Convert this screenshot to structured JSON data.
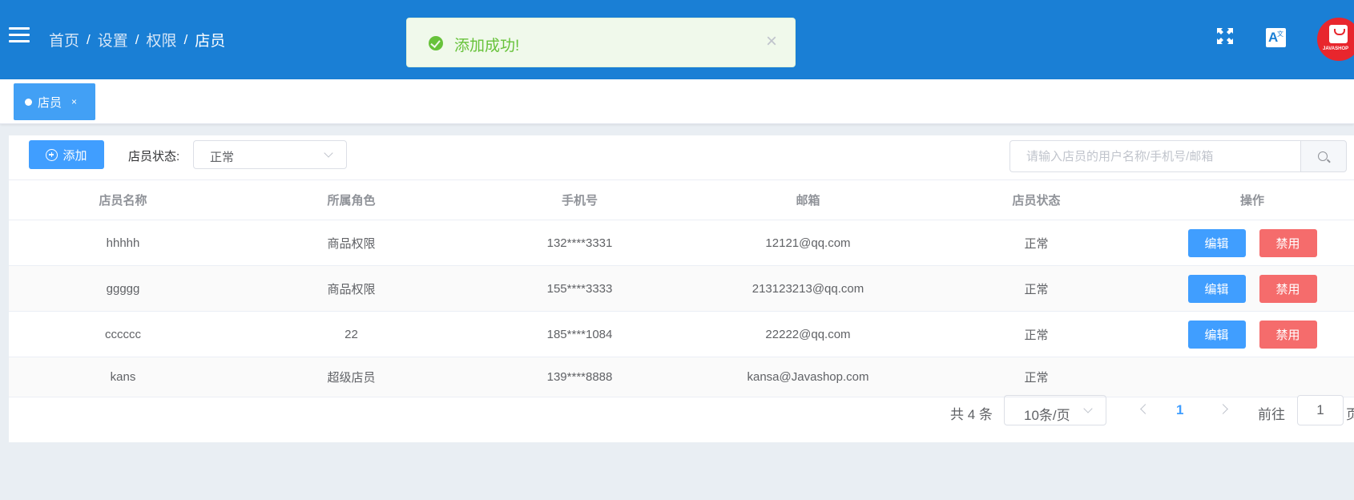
{
  "header": {
    "breadcrumb": [
      "首页",
      "设置",
      "权限",
      "店员"
    ],
    "separator": "/",
    "avatar_brand": "JAVASHOP",
    "lang_glyph_a": "A",
    "lang_glyph_b": "文"
  },
  "toast": {
    "message": "添加成功!",
    "close": "×",
    "color": "#67c23a"
  },
  "tabs": [
    {
      "label": "店员",
      "close": "×"
    }
  ],
  "toolbar": {
    "add_label": "添加",
    "status_label": "店员状态:",
    "status_value": "正常",
    "search_placeholder": "请输入店员的用户名称/手机号/邮箱"
  },
  "table": {
    "columns": [
      "店员名称",
      "所属角色",
      "手机号",
      "邮箱",
      "店员状态",
      "操作"
    ],
    "rows": [
      {
        "name": "hhhhh",
        "role": "商品权限",
        "phone": "132****3331",
        "email": "12121@qq.com",
        "status": "正常",
        "edit": "编辑",
        "disable": "禁用"
      },
      {
        "name": "ggggg",
        "role": "商品权限",
        "phone": "155****3333",
        "email": "213123213@qq.com",
        "status": "正常",
        "edit": "编辑",
        "disable": "禁用"
      },
      {
        "name": "cccccc",
        "role": "22",
        "phone": "185****1084",
        "email": "22222@qq.com",
        "status": "正常",
        "edit": "编辑",
        "disable": "禁用"
      },
      {
        "name": "kans",
        "role": "超级店员",
        "phone": "139****8888",
        "email": "kansa@Javashop.com",
        "status": "正常"
      }
    ]
  },
  "pagination": {
    "total": "共 4 条",
    "page_size": "10条/页",
    "current_page": "1",
    "goto_label": "前往",
    "goto_value": "1",
    "goto_suffix": "页"
  },
  "colors": {
    "header_bg": "#1a7fd5",
    "primary": "#409eff",
    "danger": "#f56c6c",
    "success": "#67c23a",
    "avatar_bg": "#e8262d"
  }
}
